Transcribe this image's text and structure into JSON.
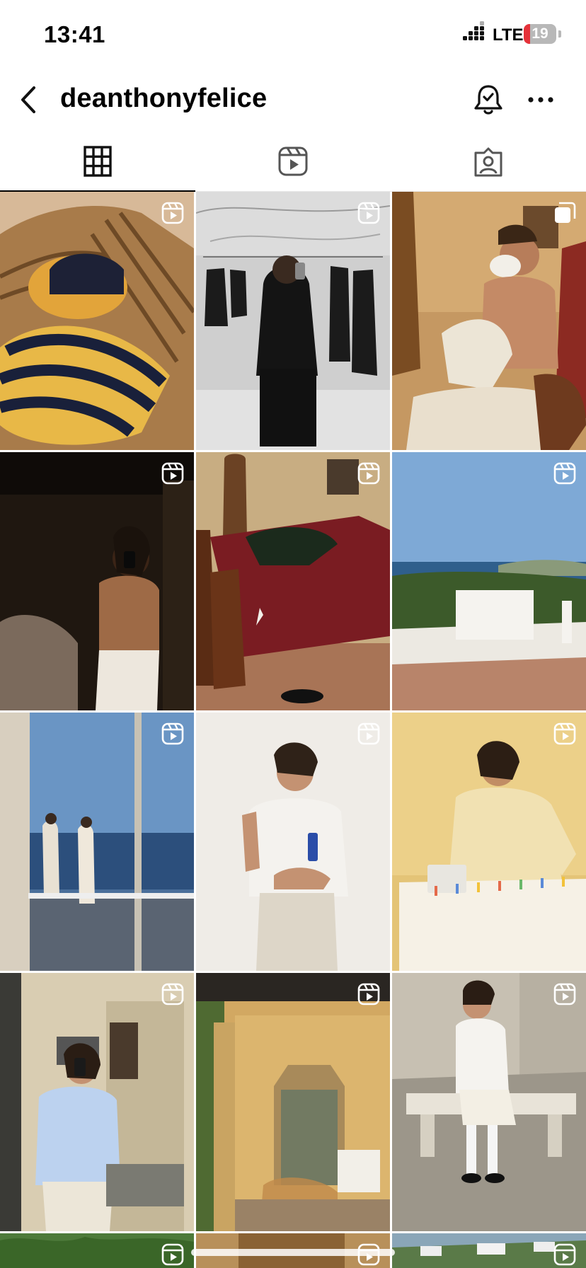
{
  "status_bar": {
    "time": "13:41",
    "network": "LTE",
    "battery": "19",
    "battery_level_percent": 19,
    "battery_color": "#e5323a"
  },
  "header": {
    "username": "deanthonyfelice",
    "icons": [
      "chevron-left-icon",
      "notification-bell-icon",
      "more-horizontal-icon"
    ]
  },
  "tabs": [
    {
      "name": "posts",
      "icon": "grid-icon",
      "active": true
    },
    {
      "name": "reels",
      "icon": "reels-icon",
      "active": false
    },
    {
      "name": "tagged",
      "icon": "tagged-person-icon",
      "active": false
    }
  ],
  "posts": [
    {
      "scene": "polo cap on striped pillow on rattan chair",
      "type": "reel"
    },
    {
      "scene": "mirror selfie in black suit in clothing store",
      "type": "reel"
    },
    {
      "scene": "shaving cream man seated in vintage room",
      "type": "carousel"
    },
    {
      "scene": "shirtless man mirror selfie in dark room",
      "type": "reel"
    },
    {
      "scene": "bed with burgundy blanket and leather bag",
      "type": "reel"
    },
    {
      "scene": "white rooftop overlooking sea",
      "type": "reel"
    },
    {
      "scene": "reflection in glass doors by the sea",
      "type": "reel"
    },
    {
      "scene": "man in white polo holding blue bottle",
      "type": "reel"
    },
    {
      "scene": "man in cream shirt at table with clothespins",
      "type": "reel"
    },
    {
      "scene": "mirror selfie in light blue shirt",
      "type": "reel"
    },
    {
      "scene": "veranda with carved door and rattan chair",
      "type": "reel"
    },
    {
      "scene": "man in white outfit sitting on stone bench",
      "type": "reel"
    },
    {
      "scene": "garden trees",
      "type": "reel"
    },
    {
      "scene": "interior",
      "type": "reel"
    },
    {
      "scene": "hillside houses",
      "type": "reel"
    }
  ],
  "colors": {
    "background": "#ffffff",
    "text": "#000000",
    "divider": "#e8e8e8"
  }
}
